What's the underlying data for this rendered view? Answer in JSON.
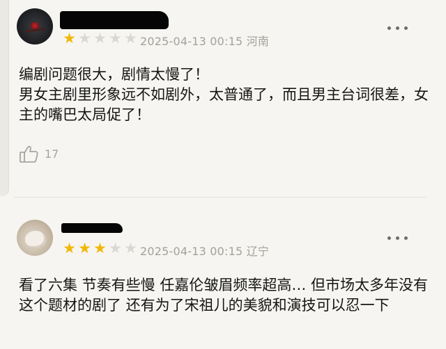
{
  "reviews": [
    {
      "rating": 1,
      "max_rating": 5,
      "date": "2025-04-13 00:15",
      "location": "河南",
      "comment": "编剧问题很大，剧情太慢了！\n男女主剧里形象远不如剧外，太普通了，而且男主台词很差，女主的嘴巴太局促了！",
      "likes": "17",
      "icons": {
        "avatar": "avatar-flower",
        "more": "more-icon",
        "like": "thumbs-up-icon"
      }
    },
    {
      "rating": 3,
      "max_rating": 5,
      "date": "2025-04-13 00:15",
      "location": "辽宁",
      "comment": "看了六集 节奏有些慢 任嘉伦皱眉频率超高… 但市场太多年没有这个题材的剧了 还有为了宋祖儿的美貌和演技可以忍一下",
      "icons": {
        "avatar": "avatar-pet",
        "more": "more-icon"
      }
    }
  ],
  "colors": {
    "background": "#f6f5f1",
    "star_active": "#f2b705",
    "star_inactive": "#d9d8d3",
    "meta_text": "#a3a19c"
  }
}
